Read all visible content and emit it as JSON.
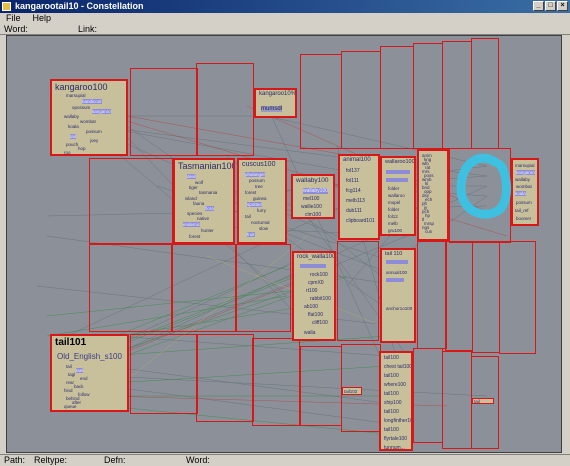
{
  "window": {
    "title": "kangarootail10 - Constellation",
    "min": "_",
    "max": "□",
    "close": "×"
  },
  "menu": {
    "file": "File",
    "help": "Help"
  },
  "fields": {
    "word": "Word:",
    "link": "Link:"
  },
  "status": {
    "path": "Path:",
    "reltype": "Reltype:",
    "defn": "Defn:",
    "word": "Word:"
  },
  "colors": {
    "accent": "#d81818",
    "canvas": "#8c9098",
    "node": "#c8c09a",
    "swirl": "#3ec0e0"
  },
  "nodes": {
    "kangaroo": {
      "title": "kangaroo100",
      "words": [
        "marsupial",
        "bandicoot",
        "opossum",
        "kangaroo",
        "wallaby",
        "wombat",
        "koala",
        "possum",
        "tail",
        "joey",
        "pouch",
        "hop",
        "roo",
        "australia"
      ]
    },
    "kangaroo10": {
      "title": "kangaroo10%",
      "sub": "mumsdl"
    },
    "tasmanian": {
      "title": "Tasmanian100",
      "words": [
        "devil",
        "wolf",
        "tiger",
        "tasmania",
        "island",
        "fauna",
        "flora",
        "species",
        "native",
        "endemic",
        "hunter",
        "forest",
        "burrow",
        "night",
        "carrion",
        "snout"
      ]
    },
    "cuscus": {
      "title": "cuscus100",
      "words": [
        "phalanger",
        "possum",
        "tree",
        "forest",
        "guinea",
        "spotted",
        "furry",
        "tail",
        "nocturnal",
        "slow",
        "fruit",
        "leaves",
        "climb",
        "grip",
        "cuscus",
        "new"
      ]
    },
    "wallaby": {
      "title": "wallaby100",
      "rows": [
        "wallaby100",
        "mel100",
        "wallie100",
        "clm100"
      ]
    },
    "animal": {
      "title": "animal100",
      "rows": [
        "fol137",
        "fol111",
        "fcg114",
        "melb113",
        "dub111",
        "clipboard101"
      ]
    },
    "wallaroo": {
      "title": "wallaroo100",
      "rows": [
        "",
        "",
        "folder",
        "wallaroo",
        "mopel",
        "folder",
        "fol12",
        "melb",
        "gru100"
      ]
    },
    "rightA": {
      "words": [
        "anim",
        "kng",
        "wlb",
        "rat",
        "mrs",
        "poss",
        "wmb",
        "kl",
        "bnd",
        "opp",
        "dsy",
        "ech",
        "plt",
        "jy",
        "pch",
        "hp",
        "tl",
        "mrsp",
        "ngs",
        "cus"
      ]
    },
    "rightB": {
      "words": [
        "marsupial",
        "kangaroo",
        "wallaby",
        "wombat",
        "koala",
        "possum",
        "tail_ref",
        "boomer"
      ]
    },
    "rock": {
      "title": "rock_walla100",
      "rows": [
        "",
        "rock100",
        "cpmX0",
        "rt100",
        "rabbit100",
        "ab100",
        "flat100",
        "cliff100",
        "walla"
      ]
    },
    "tail110": {
      "title": "tail 110",
      "rows": [
        "",
        "",
        "annual100",
        "",
        "",
        "",
        "anchor1o100"
      ]
    },
    "tail101": {
      "title": "tail101",
      "sub": "Old_English_s100",
      "words": [
        "tail",
        "tael",
        "tagl",
        "end",
        "rear",
        "back",
        "hind",
        "follow",
        "behind",
        "after",
        "queue",
        "line",
        "trail"
      ]
    },
    "tailBottom": {
      "rows": [
        "tail100",
        "chest tail100",
        "tail100",
        "where100",
        "tail100",
        "ship100",
        "tail100",
        "longfinther100",
        "tail100",
        "flyrtale100",
        "tunnum..."
      ]
    },
    "small": {
      "a": "tail102",
      "b": "tail"
    }
  }
}
